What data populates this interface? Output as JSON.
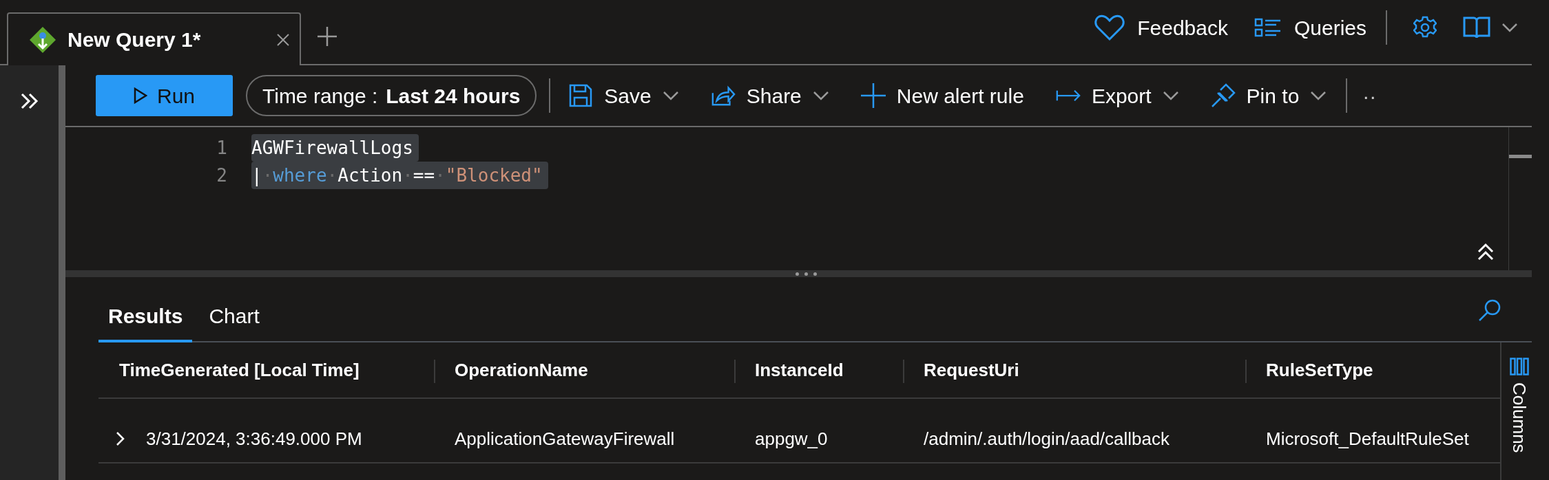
{
  "tab": {
    "title": "New Query 1*",
    "selected": true
  },
  "header_actions": [
    {
      "kind": "feedback",
      "label": "Feedback"
    },
    {
      "kind": "queries",
      "label": "Queries"
    }
  ],
  "toolbar": {
    "run": "Run",
    "time_range": {
      "label": "Time range :",
      "value": "Last 24 hours"
    },
    "actions": [
      {
        "kind": "save",
        "label": "Save",
        "dropdown": true
      },
      {
        "kind": "share",
        "label": "Share",
        "dropdown": true
      },
      {
        "kind": "alert",
        "label": "New alert rule",
        "dropdown": false
      },
      {
        "kind": "export",
        "label": "Export",
        "dropdown": true
      },
      {
        "kind": "pin",
        "label": "Pin to",
        "dropdown": true
      }
    ],
    "more": "··"
  },
  "editor": {
    "lines": [
      {
        "number": "1",
        "selected": true,
        "tokens": [
          {
            "kind": "ident",
            "text": "AGWFirewallLogs"
          }
        ]
      },
      {
        "number": "2",
        "selected": true,
        "tokens": [
          {
            "kind": "ident",
            "text": "|"
          },
          {
            "kind": "space",
            "text": "·"
          },
          {
            "kind": "keyword",
            "text": "where"
          },
          {
            "kind": "space",
            "text": "·"
          },
          {
            "kind": "ident",
            "text": "Action"
          },
          {
            "kind": "space",
            "text": "·"
          },
          {
            "kind": "ident",
            "text": "=="
          },
          {
            "kind": "space",
            "text": "·"
          },
          {
            "kind": "string",
            "text": "\"Blocked\""
          }
        ]
      }
    ]
  },
  "results": {
    "tabs": [
      {
        "label": "Results",
        "selected": true
      },
      {
        "label": "Chart",
        "selected": false
      }
    ],
    "columns": [
      "TimeGenerated [Local Time]",
      "OperationName",
      "InstanceId",
      "RequestUri",
      "RuleSetType"
    ],
    "rows": [
      {
        "expanded": false,
        "cells": [
          "3/31/2024, 3:36:49.000 PM",
          "ApplicationGatewayFirewall",
          "appgw_0",
          "/admin/.auth/login/aad/callback",
          "Microsoft_DefaultRuleSet"
        ]
      }
    ],
    "columns_panel": "Columns"
  }
}
